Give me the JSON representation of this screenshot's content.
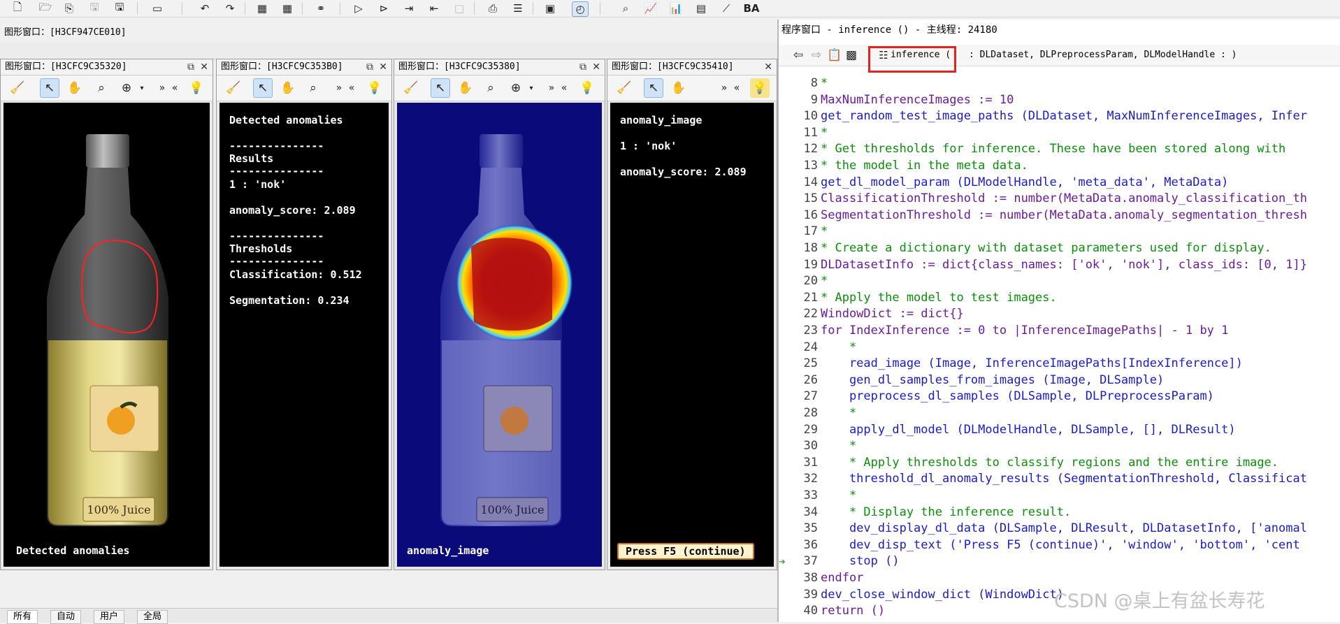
{
  "toolbar": {
    "icons": [
      "new-file-icon",
      "open-file-icon",
      "insert-file-icon",
      "save-disabled-icon",
      "save-icon",
      "record-icon",
      "undo-icon",
      "redo-icon",
      "insert-procedure-icon",
      "delete-procedure-icon",
      "find-icon",
      "run-icon",
      "step-over-icon",
      "step-into-icon",
      "step-out-icon",
      "stop-icon",
      "breakpoint-icon",
      "activate-icon",
      "variable-inspect-icon",
      "profiler-icon",
      "zoom-icon",
      "histogram-icon",
      "line-profile-icon",
      "feature-inspect-icon",
      "gray-histogram-icon",
      "ocr-icon"
    ]
  },
  "graphics_main": {
    "title": "图形窗口：[H3CF947CE010]"
  },
  "windows": [
    {
      "title": "图形窗口：[H3CFC9C35320]",
      "caption": "Detected anomalies"
    },
    {
      "title": "图形窗口：[H3CFC9C353B0]",
      "lines": [
        "Detected anomalies",
        "---------------",
        "Results",
        "---------------",
        "1 : 'nok'",
        "anomaly_score: 2.089",
        "---------------",
        "Thresholds",
        "---------------",
        "Classification: 0.512",
        "Segmentation: 0.234"
      ]
    },
    {
      "title": "图形窗口：[H3CFC9C35380]",
      "caption": "anomaly_image"
    },
    {
      "title": "图形窗口：[H3CFC9C35410]",
      "lines": [
        "anomaly_image",
        "1 : 'nok'",
        "anomaly_score: 2.089"
      ],
      "button": "Press F5 (continue)"
    }
  ],
  "bottle_label": "100% Juice",
  "code_window": {
    "title": "程序窗口 - inference () - 主线程: 24180",
    "procedure": "inference (",
    "signature": ": DLDataset, DLPreprocessParam, DLModelHandle : )",
    "lines": [
      {
        "n": "8",
        "t": "*"
      },
      {
        "n": "9",
        "t": "MaxNumInferenceImages := 10"
      },
      {
        "n": "10",
        "t": "get_random_test_image_paths (DLDataset, MaxNumInferenceImages, Infer"
      },
      {
        "n": "11",
        "t": "*"
      },
      {
        "n": "12",
        "t": "* Get thresholds for inference. These have been stored along with"
      },
      {
        "n": "13",
        "t": "* the model in the meta data."
      },
      {
        "n": "14",
        "t": "get_dl_model_param (DLModelHandle, 'meta_data', MetaData)"
      },
      {
        "n": "15",
        "t": "ClassificationThreshold := number(MetaData.anomaly_classification_th"
      },
      {
        "n": "16",
        "t": "SegmentationThreshold := number(MetaData.anomaly_segmentation_thresh"
      },
      {
        "n": "17",
        "t": "*"
      },
      {
        "n": "18",
        "t": "* Create a dictionary with dataset parameters used for display."
      },
      {
        "n": "19",
        "t": "DLDatasetInfo := dict{class_names: ['ok', 'nok'], class_ids: [0, 1]}"
      },
      {
        "n": "20",
        "t": "*"
      },
      {
        "n": "21",
        "t": "* Apply the model to test images."
      },
      {
        "n": "22",
        "t": "WindowDict := dict{}"
      },
      {
        "n": "23",
        "t": "for IndexInference := 0 to |InferenceImagePaths| - 1 by 1"
      },
      {
        "n": "24",
        "t": "    *"
      },
      {
        "n": "25",
        "t": "    read_image (Image, InferenceImagePaths[IndexInference])"
      },
      {
        "n": "26",
        "t": "    gen_dl_samples_from_images (Image, DLSample)"
      },
      {
        "n": "27",
        "t": "    preprocess_dl_samples (DLSample, DLPreprocessParam)"
      },
      {
        "n": "28",
        "t": "    *"
      },
      {
        "n": "29",
        "t": "    apply_dl_model (DLModelHandle, DLSample, [], DLResult)"
      },
      {
        "n": "30",
        "t": "    *"
      },
      {
        "n": "31",
        "t": "    * Apply thresholds to classify regions and the entire image."
      },
      {
        "n": "32",
        "t": "    threshold_dl_anomaly_results (SegmentationThreshold, Classificat"
      },
      {
        "n": "33",
        "t": "    *"
      },
      {
        "n": "34",
        "t": "    * Display the inference result."
      },
      {
        "n": "35",
        "t": "    dev_display_dl_data (DLSample, DLResult, DLDatasetInfo, ['anomal"
      },
      {
        "n": "36",
        "t": "    dev_disp_text ('Press F5 (continue)', 'window', 'bottom', 'cent"
      },
      {
        "n": "37",
        "t": "    stop ()"
      },
      {
        "n": "38",
        "t": "endfor"
      },
      {
        "n": "39",
        "t": "dev_close_window_dict (WindowDict)"
      },
      {
        "n": "40",
        "t": "return ()"
      }
    ]
  },
  "bottom_tabs": [
    "所有",
    "自动",
    "用户",
    "全局"
  ],
  "watermark": "CSDN @桌上有盆长寿花"
}
